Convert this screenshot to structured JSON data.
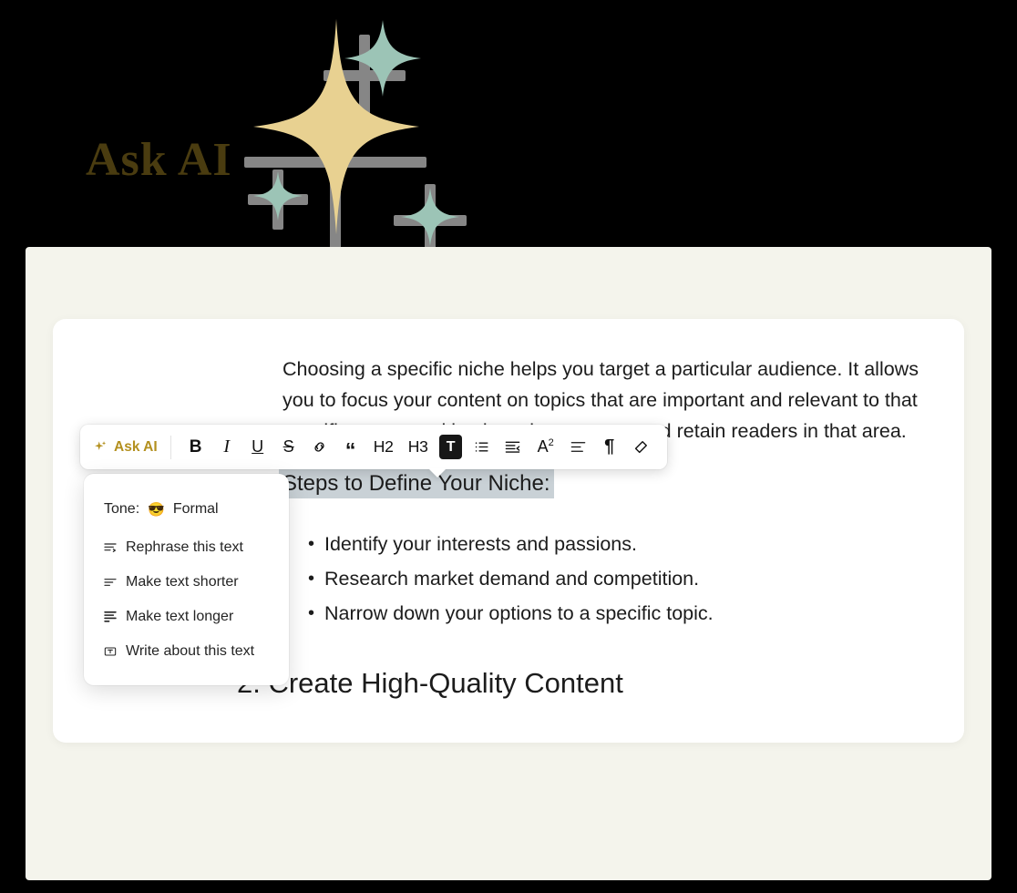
{
  "hero": {
    "title": "Ask AI",
    "colors": {
      "title": "#4a3c10",
      "gold_spark": "#e8d191",
      "teal_spark": "#9cc4b6",
      "glow": "#d9d9d9"
    },
    "sparkles": [
      {
        "name": "sparkle-gold-large",
        "kind": "star",
        "color": "#e8d191"
      },
      {
        "name": "sparkle-teal-top",
        "kind": "star",
        "color": "#9cc4b6"
      },
      {
        "name": "sparkle-teal-left",
        "kind": "star",
        "color": "#9cc4b6"
      },
      {
        "name": "sparkle-teal-bottom",
        "kind": "star",
        "color": "#9cc4b6"
      }
    ]
  },
  "toolbar": {
    "ask_ai_label": "Ask AI",
    "ask_ai_icon": "sparkles-icon",
    "accent_color": "#b3901f",
    "buttons": [
      {
        "name": "bold-button",
        "icon": "bold-icon",
        "label": "B",
        "class": "bold",
        "active": false
      },
      {
        "name": "italic-button",
        "icon": "italic-icon",
        "label": "I",
        "class": "italic",
        "active": false
      },
      {
        "name": "underline-button",
        "icon": "underline-icon",
        "label": "U",
        "class": "under",
        "active": false
      },
      {
        "name": "strikethrough-button",
        "icon": "strikethrough-icon",
        "label": "S",
        "class": "strike",
        "active": false
      },
      {
        "name": "link-button",
        "icon": "link-icon",
        "label": "",
        "class": "svg",
        "active": false
      },
      {
        "name": "blockquote-button",
        "icon": "quote-icon",
        "label": "“",
        "class": "quote",
        "active": false
      },
      {
        "name": "heading-2-button",
        "icon": "h2-icon",
        "label": "H2",
        "class": "hx",
        "active": false
      },
      {
        "name": "heading-3-button",
        "icon": "h3-icon",
        "label": "H3",
        "class": "hx",
        "active": false
      },
      {
        "name": "text-color-button",
        "icon": "text-color-icon",
        "label": "T",
        "class": "active",
        "active": true
      },
      {
        "name": "bullet-list-button",
        "icon": "bullet-list-icon",
        "label": "",
        "class": "svg",
        "active": false
      },
      {
        "name": "outdent-button",
        "icon": "outdent-icon",
        "label": "",
        "class": "svg",
        "active": false
      },
      {
        "name": "superscript-button",
        "icon": "superscript-icon",
        "label": "A",
        "class": "sup-a",
        "active": false
      },
      {
        "name": "align-left-button",
        "icon": "align-left-icon",
        "label": "",
        "class": "svg",
        "active": false
      },
      {
        "name": "paragraph-mark-button",
        "icon": "pilcrow-icon",
        "label": "¶",
        "class": "pil",
        "active": false
      },
      {
        "name": "clear-format-button",
        "icon": "eraser-icon",
        "label": "",
        "class": "svg",
        "active": false
      }
    ]
  },
  "ai_menu": {
    "tone_label": "Tone:",
    "tone_emoji": "😎",
    "tone_value": "Formal",
    "items": [
      {
        "name": "menu-item-rephrase",
        "icon": "rephrase-icon",
        "label": "Rephrase this text"
      },
      {
        "name": "menu-item-shorter",
        "icon": "shorten-icon",
        "label": "Make text shorter"
      },
      {
        "name": "menu-item-longer",
        "icon": "lengthen-icon",
        "label": "Make text longer"
      },
      {
        "name": "menu-item-write-about",
        "icon": "write-about-icon",
        "label": "Write about this text"
      }
    ]
  },
  "document": {
    "paragraph": "Choosing a specific niche helps you target a particular audience. It allows you to focus your content on topics that are important and relevant to that specific group, making it easier to attract and retain readers in that area.",
    "heading_selected": "Steps to Define Your Niche:",
    "selection_color": "#c9d1d6",
    "bullets": [
      "Identify your interests and passions.",
      "Research market demand and competition.",
      "Narrow down your options to a specific topic."
    ],
    "next_heading": "2. Create High-Quality Content"
  },
  "colors": {
    "page_background": "#000000",
    "panel_background": "#f4f4ec",
    "card_background": "#ffffff",
    "text": "#1c1c1c"
  }
}
